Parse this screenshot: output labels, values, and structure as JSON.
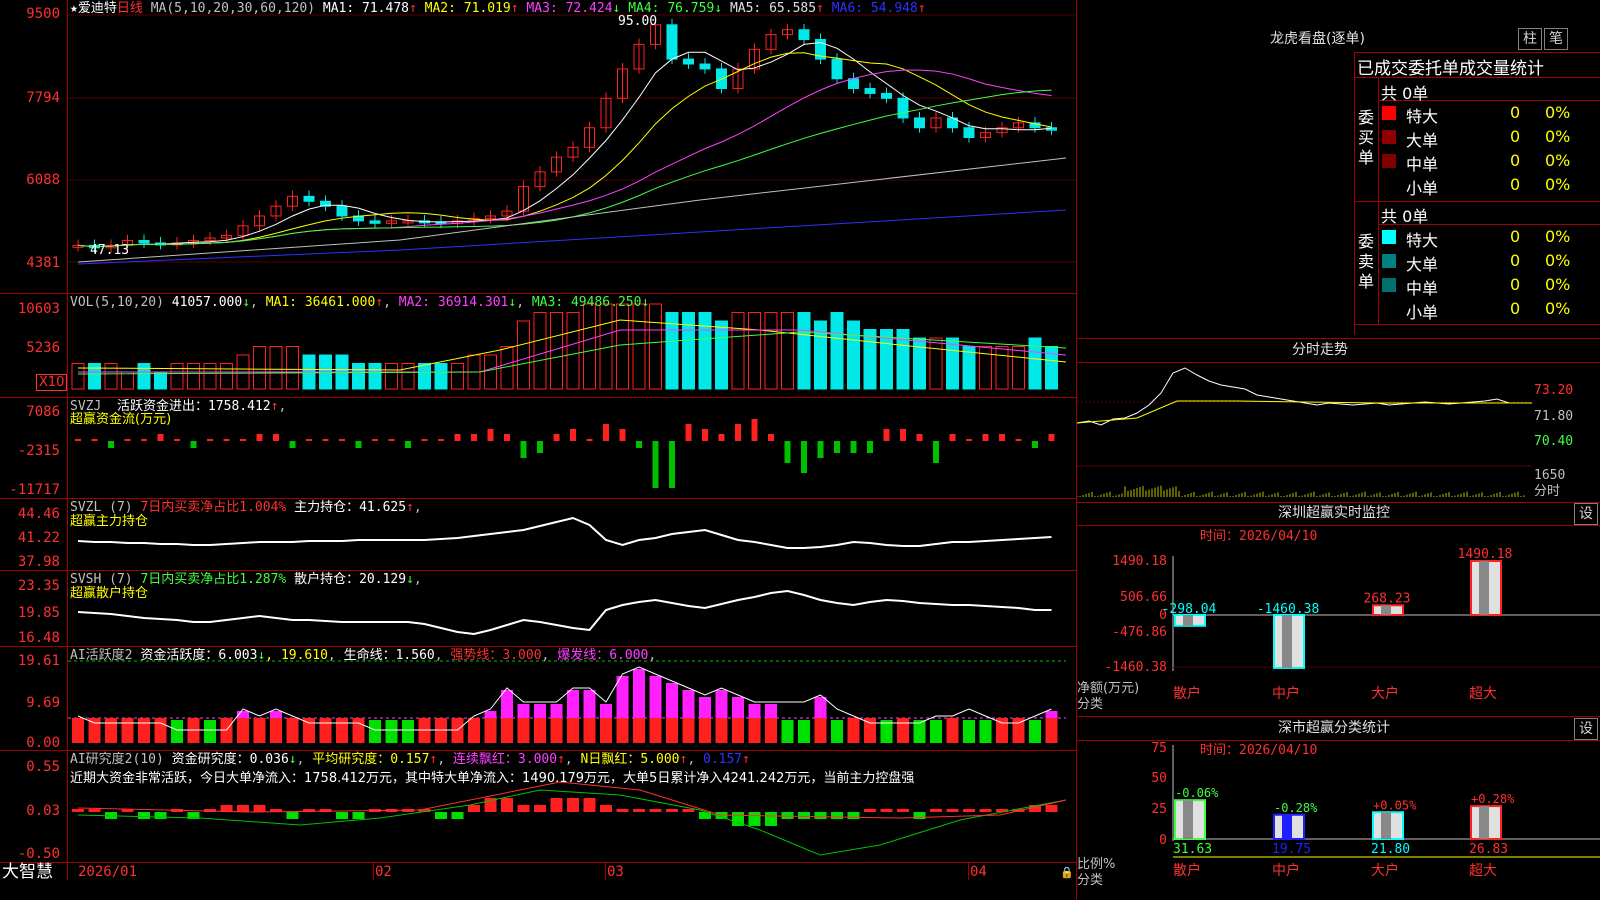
{
  "app": {
    "name": "大智慧",
    "stock": "爱迪特",
    "period": "日线"
  },
  "colors": {
    "up": "#ff2020",
    "down": "#00e8e8",
    "grid": "#a00000",
    "ma1": "#ffffff",
    "ma2": "#ffff00",
    "ma3": "#ff40ff",
    "ma4": "#40ff40",
    "ma5": "#c0c0c0",
    "ma6": "#3030ff"
  },
  "kline": {
    "legend_prefix": "★",
    "ma_label": "MA(5,10,20,30,60,120)",
    "ma": [
      {
        "name": "MA1:",
        "value": "71.478",
        "arrow": "↑"
      },
      {
        "name": "MA2:",
        "value": "71.019",
        "arrow": "↑"
      },
      {
        "name": "MA3:",
        "value": "72.424",
        "arrow": "↓"
      },
      {
        "name": "MA4:",
        "value": "76.759",
        "arrow": "↓"
      },
      {
        "name": "MA5:",
        "value": "65.585",
        "arrow": "↑"
      },
      {
        "name": "MA6:",
        "value": "54.948",
        "arrow": "↑"
      }
    ],
    "y_ticks": [
      "9500",
      "7794",
      "6088",
      "4381"
    ],
    "high_mark": "95.00",
    "low_mark": "47.13"
  },
  "vol": {
    "label": "VOL(5,10,20)",
    "value": "41057.000",
    "value_arrow": "↓",
    "ma": [
      {
        "name": "MA1:",
        "value": "36461.000",
        "arrow": "↑"
      },
      {
        "name": "MA2:",
        "value": "36914.301",
        "arrow": "↓"
      },
      {
        "name": "MA3:",
        "value": "49486.250",
        "arrow": "↓"
      }
    ],
    "y_ticks": [
      "10603",
      "5236"
    ],
    "unit": "X10"
  },
  "svzj": {
    "label": "SVZJ",
    "text1": "活跃资金进出：",
    "value": "1758.412",
    "arrow": "↑",
    "sep": ",",
    "line2": "超赢资金流(万元)",
    "y_ticks": [
      "7086",
      "-2315",
      "-11717"
    ]
  },
  "svzl": {
    "label": "SVZL (7)",
    "text1": "7日内买卖净占比1.004%",
    "text2": "主力持仓：",
    "value": "41.625",
    "arrow": "↑",
    "sep": ",",
    "line2": "超赢主力持仓",
    "y_ticks": [
      "44.46",
      "41.22",
      "37.98"
    ]
  },
  "svsh": {
    "label": "SVSH (7)",
    "text1": "7日内买卖净占比1.287%",
    "text2": "散户持仓：",
    "value": "20.129",
    "arrow": "↓",
    "sep": ",",
    "line2": "超赢散户持仓",
    "y_ticks": [
      "23.35",
      "19.85",
      "16.48"
    ]
  },
  "ai1": {
    "label": "AI活跃度2",
    "a": "资金活跃度：",
    "av": "6.003",
    "aa": "↓",
    "b": "19.610",
    "c": "生命线：",
    "cv": "1.560",
    "d": "强势线：",
    "dv": "3.000",
    "e": "爆发线：",
    "ev": "6.000",
    "y_ticks": [
      "19.61",
      "9.69",
      "0.00"
    ]
  },
  "ai2": {
    "label": "AI研究度2(10)",
    "a": "资金研究度：",
    "av": "0.036",
    "aa": "↓",
    "b": "平均研究度：",
    "bv": "0.157",
    "ba": "↑",
    "c": "连续飘红：",
    "cv": "3.000",
    "ca": "↑",
    "d": "N日飘红：",
    "dv": "5.000",
    "da": "↑",
    "e": "0.157",
    "ea": "↑",
    "note": "近期大资金非常活跃，今日大单净流入：1758.412万元，其中特大单净流入：1490.179万元，大单5日累计净入4241.242万元，当前主力控盘强",
    "y_ticks": [
      "0.55",
      "0.03",
      "-0.50"
    ]
  },
  "dates": [
    "2026/01",
    "02",
    "03",
    "04"
  ],
  "right": {
    "lhb_title": "龙虎看盘(逐单)",
    "btn_zhu": "柱",
    "btn_bi": "笔",
    "header": "已成交委托单成交量统计",
    "buy": {
      "side": "委买单",
      "total": "共 0单",
      "rows": [
        {
          "name": "特大",
          "v": "0",
          "p": "0%",
          "color": "#ff0000"
        },
        {
          "name": "大单",
          "v": "0",
          "p": "0%",
          "color": "#900000"
        },
        {
          "name": "中单",
          "v": "0",
          "p": "0%",
          "color": "#800000"
        },
        {
          "name": "小单",
          "v": "0",
          "p": "0%",
          "color": "#000000"
        }
      ]
    },
    "sell": {
      "side": "委卖单",
      "total": "共 0单",
      "rows": [
        {
          "name": "特大",
          "v": "0",
          "p": "0%",
          "color": "#00ffff"
        },
        {
          "name": "大单",
          "v": "0",
          "p": "0%",
          "color": "#008080"
        },
        {
          "name": "中单",
          "v": "0",
          "p": "0%",
          "color": "#007070"
        },
        {
          "name": "小单",
          "v": "0",
          "p": "0%",
          "color": "#000000"
        }
      ]
    },
    "intraday": {
      "title": "分时走势",
      "y": [
        "73.20",
        "71.80",
        "70.40"
      ],
      "vol": "1650",
      "vol_unit": "分时"
    },
    "sz_monitor": {
      "title": "深圳超赢实时监控",
      "btn": "设",
      "time": "时间：2026/04/10",
      "y": [
        "1490.18",
        "506.66",
        "0",
        "-476.86",
        "-1460.38"
      ],
      "bars": [
        {
          "cat": "散户",
          "value": -298.04,
          "label": "-298.04"
        },
        {
          "cat": "中户",
          "value": -1460.38,
          "label": "-1460.38"
        },
        {
          "cat": "大户",
          "value": 268.23,
          "label": "268.23"
        },
        {
          "cat": "超大",
          "value": 1490.18,
          "label": "1490.18"
        }
      ],
      "ylabel": "净额(万元)",
      "xlabel": "分类"
    },
    "sz_class": {
      "title": "深市超赢分类统计",
      "btn": "设",
      "time": "时间：2026/04/10",
      "y": [
        "75",
        "50",
        "25",
        "0"
      ],
      "bars": [
        {
          "cat": "散户",
          "value": 31.63,
          "label": "31.63",
          "chg": "-0.06%"
        },
        {
          "cat": "中户",
          "value": 19.75,
          "label": "19.75",
          "chg": "-0.28%"
        },
        {
          "cat": "大户",
          "value": 21.8,
          "label": "21.80",
          "chg": "+0.05%"
        },
        {
          "cat": "超大",
          "value": 26.83,
          "label": "26.83",
          "chg": "+0.28%"
        }
      ],
      "ylabel": "比例%",
      "xlabel": "分类"
    }
  }
}
